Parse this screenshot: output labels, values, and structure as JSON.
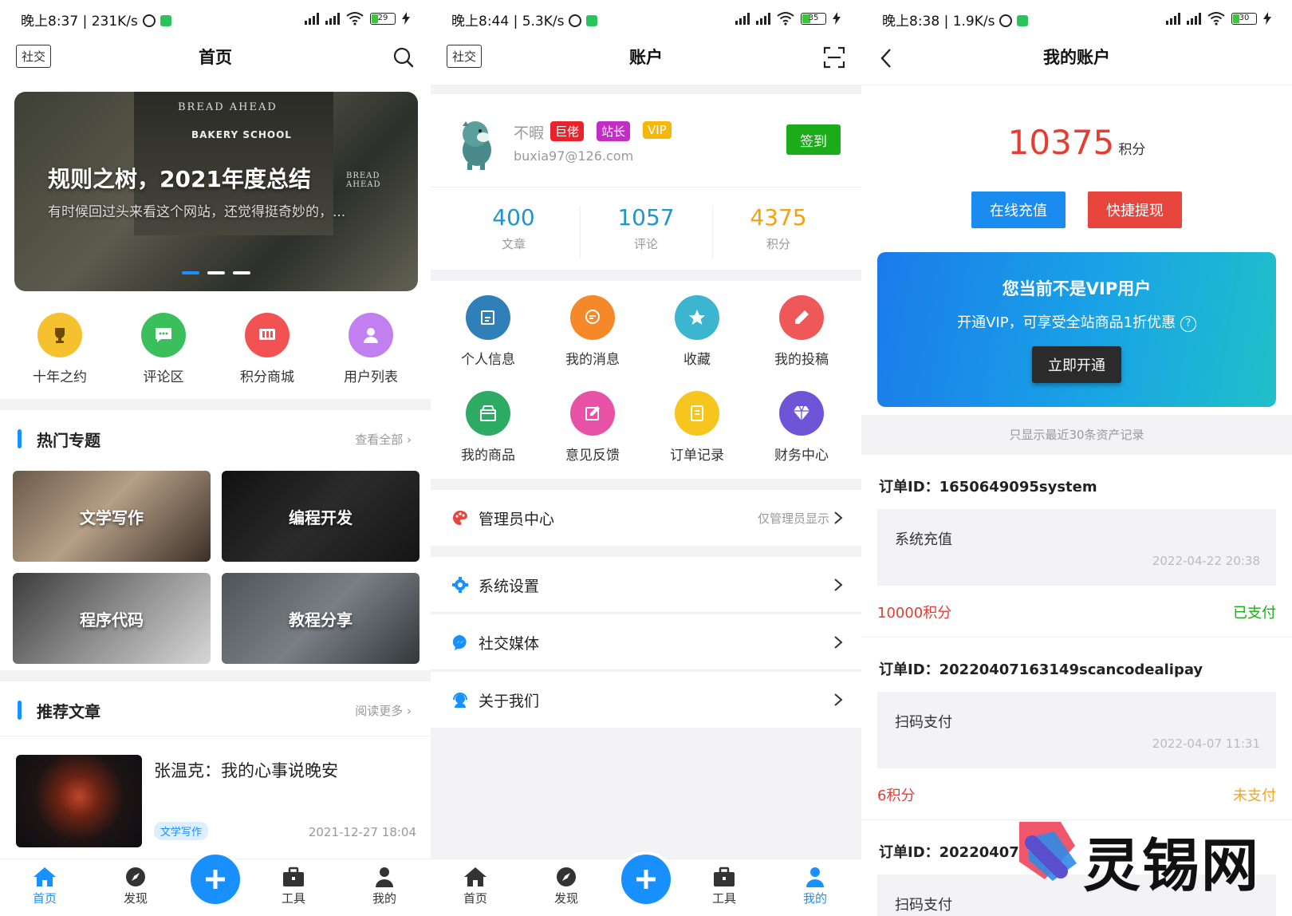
{
  "colors": {
    "accent": "#1890ff",
    "red": "#e43d33",
    "green": "#1aad19",
    "orange": "#f5a623"
  },
  "screen1": {
    "status": "晚上8:37 | 231K/s",
    "battery": "29",
    "header": {
      "tag": "社交",
      "title": "首页"
    },
    "banner": {
      "title": "规则之树，2021年度总结",
      "subtitle": "有时候回过头来看这个网站，还觉得挺奇妙的，...",
      "sign_top": "BREAD AHEAD",
      "sign_mid": "BAKERY SCHOOL",
      "sign_side": "BREAD AHEAD"
    },
    "quick": [
      {
        "label": "十年之约",
        "color": "#f5c12e",
        "icon": "trophy-icon"
      },
      {
        "label": "评论区",
        "color": "#3bbf5c",
        "icon": "comment-icon"
      },
      {
        "label": "积分商城",
        "color": "#f25252",
        "icon": "shop-icon"
      },
      {
        "label": "用户列表",
        "color": "#c17ff0",
        "icon": "user-icon"
      }
    ],
    "hot": {
      "title": "热门专题",
      "more": "查看全部"
    },
    "topics": [
      "文学写作",
      "编程开发",
      "程序代码",
      "教程分享"
    ],
    "recommend": {
      "title": "推荐文章",
      "more": "阅读更多"
    },
    "article": {
      "title": "张温克：我的心事说晚安",
      "tag": "文学写作",
      "date": "2021-12-27 18:04"
    },
    "tabs": [
      "首页",
      "发现",
      "工具",
      "我的"
    ]
  },
  "screen2": {
    "status": "晚上8:44 | 5.3K/s",
    "battery": "35",
    "header": {
      "tag": "社交",
      "title": "账户"
    },
    "user": {
      "name": "不暇",
      "email": "buxia97@126.com",
      "signin": "签到"
    },
    "badges": [
      {
        "label": "巨佬",
        "color": "#e8232c"
      },
      {
        "label": "站长",
        "color": "#c12ec6"
      },
      {
        "label": "VIP",
        "color": "#f5b70a"
      }
    ],
    "stats": [
      {
        "value": "400",
        "label": "文章",
        "color": "#2196c8"
      },
      {
        "value": "1057",
        "label": "评论",
        "color": "#2196c8"
      },
      {
        "value": "4375",
        "label": "积分",
        "color": "#f2a20e"
      }
    ],
    "grid": [
      {
        "label": "个人信息",
        "color": "#2f7fb8",
        "icon": "edit-icon"
      },
      {
        "label": "我的消息",
        "color": "#f5892a",
        "icon": "message-icon"
      },
      {
        "label": "收藏",
        "color": "#3bb5d0",
        "icon": "star-icon"
      },
      {
        "label": "我的投稿",
        "color": "#ef5858",
        "icon": "pencil-icon"
      },
      {
        "label": "我的商品",
        "color": "#2daa63",
        "icon": "box-icon"
      },
      {
        "label": "意见反馈",
        "color": "#e752a6",
        "icon": "feedback-icon"
      },
      {
        "label": "订单记录",
        "color": "#f7c61e",
        "icon": "order-icon"
      },
      {
        "label": "财务中心",
        "color": "#6e55d8",
        "icon": "diamond-icon"
      }
    ],
    "admin": {
      "label": "管理员中心",
      "note": "仅管理员显示"
    },
    "menu": [
      "系统设置",
      "社交媒体",
      "关于我们"
    ],
    "tabs": [
      "首页",
      "发现",
      "工具",
      "我的"
    ]
  },
  "screen3": {
    "status": "晚上8:38 | 1.9K/s",
    "battery": "30",
    "header": {
      "title": "我的账户"
    },
    "points": {
      "value": "10375",
      "unit": "积分"
    },
    "recharge": "在线充值",
    "withdraw": "快捷提现",
    "vip": {
      "title": "您当前不是VIP用户",
      "subtitle": "开通VIP，可享受全站商品1折优惠",
      "button": "立即开通"
    },
    "note": "只显示最近30条资产记录",
    "orders": [
      {
        "id": "订单ID：1650649095system",
        "name": "系统充值",
        "date": "2022-04-22 20:38",
        "amount": "10000积分",
        "status": "已支付",
        "status_color": "#1aad19"
      },
      {
        "id": "订单ID：20220407163149scancodealipay",
        "name": "扫码支付",
        "date": "2022-04-07 11:31",
        "amount": "6积分",
        "status": "未支付",
        "status_color": "#f5a623"
      },
      {
        "id": "订单ID：202204070",
        "name": "扫码支付",
        "date": "",
        "amount": "",
        "status": "",
        "status_color": "#1aad19"
      }
    ],
    "watermark": "灵锡网"
  }
}
